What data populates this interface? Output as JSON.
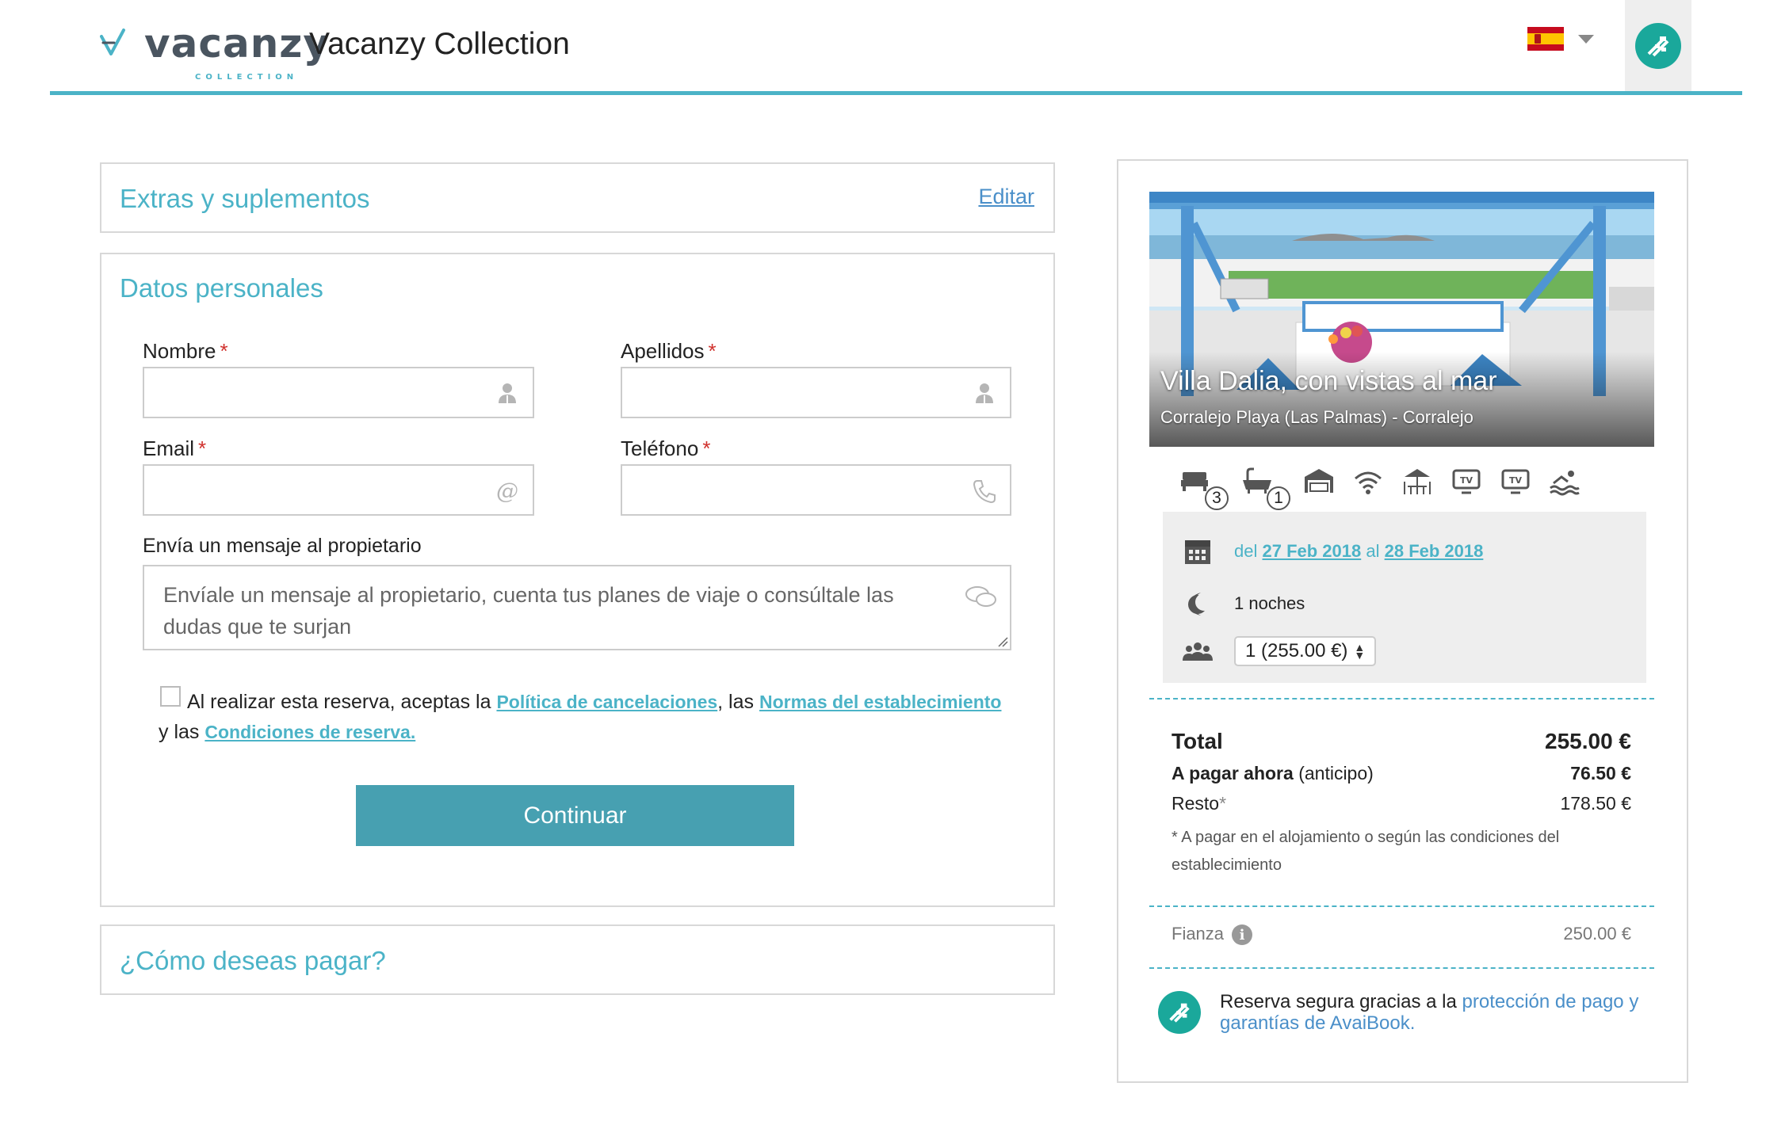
{
  "header": {
    "logo_word": "vacanzy",
    "logo_sub": "COLLECTION",
    "site_title": "Vacanzy Collection",
    "language_flag": "spain-flag",
    "brand_color": "#4bb3c7"
  },
  "extras": {
    "title": "Extras y suplementos",
    "edit_label": "Editar"
  },
  "personal": {
    "title": "Datos personales",
    "nombre_label": "Nombre",
    "apellidos_label": "Apellidos",
    "email_label": "Email",
    "telefono_label": "Teléfono",
    "required_mark": "*",
    "nombre_value": "",
    "apellidos_value": "",
    "email_value": "",
    "telefono_value": "",
    "message_label": "Envía un mensaje al propietario",
    "message_placeholder": "Envíale un mensaje al propietario, cuenta tus planes de viaje o consúltale las dudas que te surjan",
    "terms_prefix": "Al realizar esta reserva, aceptas la",
    "terms_link1": "Política de cancelaciones",
    "terms_mid1": ", las",
    "terms_link2": "Normas del establecimiento",
    "terms_mid2": " y las",
    "terms_link3": "Condiciones de reserva.",
    "continue_label": "Continuar"
  },
  "payment": {
    "title": "¿Cómo deseas pagar?"
  },
  "property": {
    "name": "Villa Dalia, con vistas al mar",
    "location": "Corralejo Playa (Las Palmas) - Corralejo",
    "bedrooms": "3",
    "bathrooms": "1",
    "amenities": [
      "bed-icon",
      "bathtub-icon",
      "garage-icon",
      "wifi-icon",
      "terrace-icon",
      "tv-icon",
      "tv-icon",
      "pool-icon"
    ]
  },
  "stay": {
    "dates_prefix": "del",
    "date_from": "27 Feb 2018",
    "dates_mid": "al",
    "date_to": "28 Feb 2018",
    "nights": "1 noches",
    "guests_selected": "1 (255.00 €)"
  },
  "totals": {
    "total_label": "Total",
    "total_value": "255.00 €",
    "now_label": "A pagar ahora",
    "now_suffix": "(anticipo)",
    "now_value": "76.50 €",
    "rest_label": "Resto",
    "rest_mark": "*",
    "rest_value": "178.50 €",
    "note": "* A pagar en el alojamiento o según las condiciones del establecimiento",
    "deposit_label": "Fianza",
    "deposit_value": "250.00 €"
  },
  "secure": {
    "text": "Reserva segura gracias a la",
    "link": "protección de pago y garantías de AvaiBook."
  }
}
